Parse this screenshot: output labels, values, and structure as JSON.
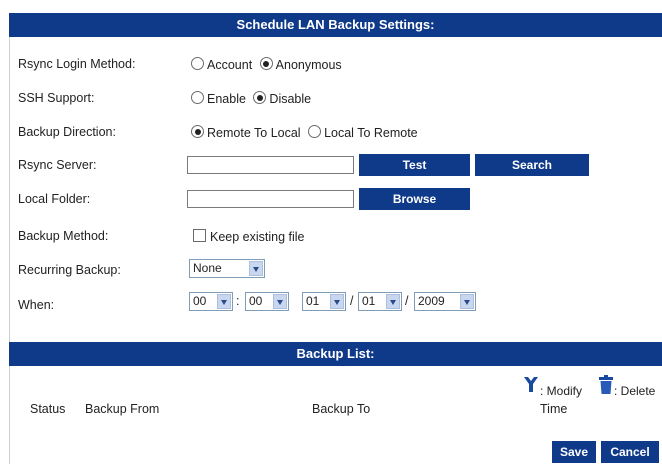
{
  "settings": {
    "title": "Schedule LAN Backup Settings:",
    "rsync_login": {
      "label": "Rsync Login Method:",
      "options": [
        "Account",
        "Anonymous"
      ],
      "selected": "Anonymous"
    },
    "ssh_support": {
      "label": "SSH Support:",
      "options": [
        "Enable",
        "Disable"
      ],
      "selected": "Disable"
    },
    "backup_direction": {
      "label": "Backup Direction:",
      "options": [
        "Remote To Local",
        "Local To Remote"
      ],
      "selected": "Remote To Local"
    },
    "rsync_server": {
      "label": "Rsync Server:",
      "value": "",
      "test_label": "Test",
      "search_label": "Search"
    },
    "local_folder": {
      "label": "Local Folder:",
      "value": "",
      "browse_label": "Browse"
    },
    "backup_method": {
      "label": "Backup Method:",
      "checkbox_label": "Keep existing file",
      "checked": false
    },
    "recurring": {
      "label": "Recurring Backup:",
      "value": "None"
    },
    "when": {
      "label": "When:",
      "hour": "00",
      "minute": "00",
      "time_sep": ":",
      "month": "01",
      "day": "01",
      "year": "2009",
      "date_sep": "/"
    }
  },
  "backup_list": {
    "title": "Backup List:",
    "modify_label": ": Modify",
    "delete_label": ": Delete",
    "columns": {
      "status": "Status",
      "from": "Backup From",
      "to": "Backup To",
      "time": "Time"
    }
  },
  "footer": {
    "save_label": "Save",
    "cancel_label": "Cancel"
  },
  "colors": {
    "header": "#0f3a8a",
    "button": "#0f3a8a"
  }
}
